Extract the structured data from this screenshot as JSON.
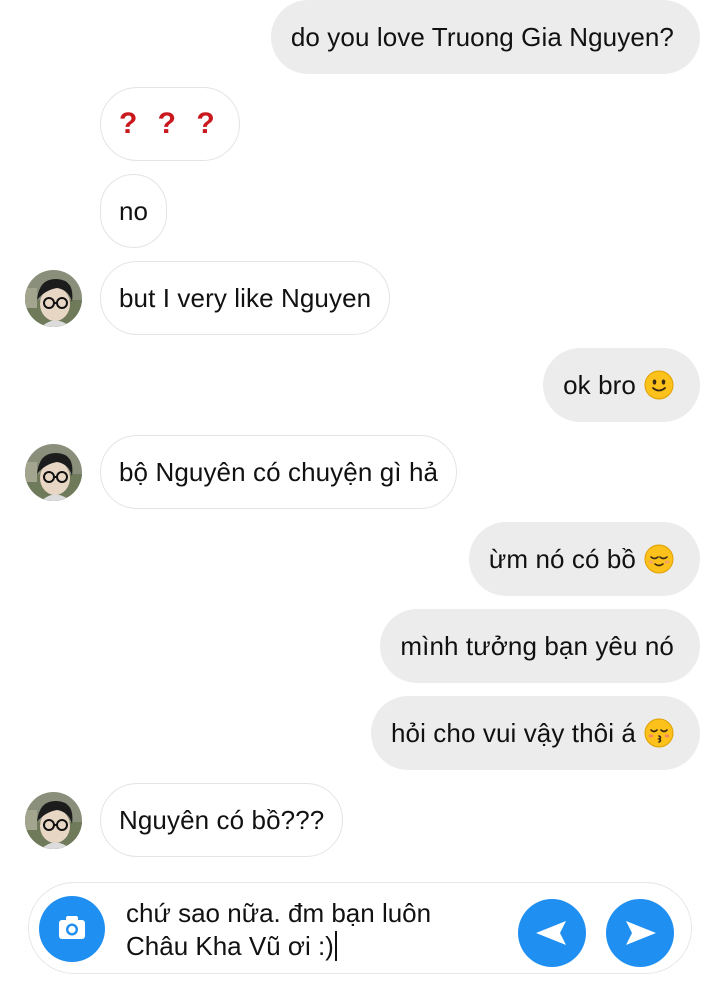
{
  "messages": [
    {
      "side": "out",
      "text": "do you love Truong Gia Nguyen?"
    },
    {
      "side": "in",
      "text": "? ? ?",
      "style": "qmarks"
    },
    {
      "side": "in",
      "text": "no"
    },
    {
      "side": "in",
      "text": "but I very like Nguyen",
      "avatar": true
    },
    {
      "side": "out",
      "text": "ok bro",
      "emoji": "slightly-smiling-emoji"
    },
    {
      "side": "in",
      "text": "bộ Nguyên có chuyện gì hả",
      "avatar": true
    },
    {
      "side": "out",
      "text": "ừm nó có bồ",
      "emoji": "relieved-emoji"
    },
    {
      "side": "out",
      "text": "mình tưởng bạn yêu nó"
    },
    {
      "side": "out",
      "text": "hỏi cho vui vậy thôi á",
      "emoji": "kissing-emoji"
    },
    {
      "side": "in",
      "text": "Nguyên có bồ???",
      "avatar": true
    }
  ],
  "composer": {
    "text_line1": "chứ sao nữa. đm bạn luôn",
    "text_line2": "Châu Kha Vũ ơi :)",
    "left_icon": "camera-icon",
    "buttons": [
      "back-arrow-icon",
      "send-icon"
    ]
  },
  "colors": {
    "accent": "#1f8ff2",
    "outgoing_bubble": "#ececec",
    "incoming_bubble": "#ffffff",
    "question_marks": "#c9191e"
  }
}
